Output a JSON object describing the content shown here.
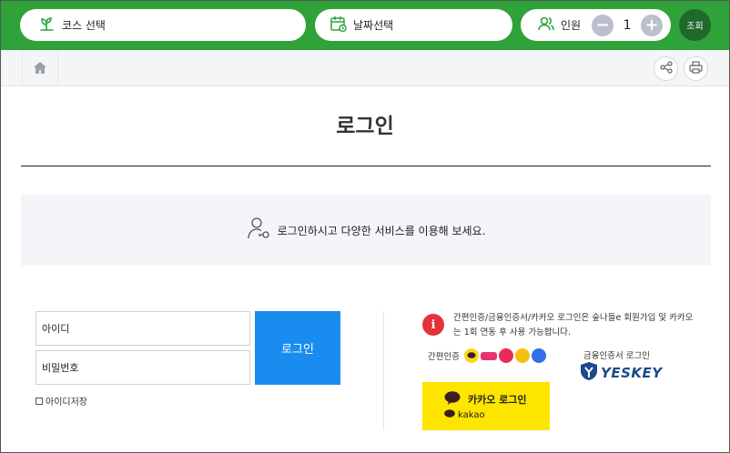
{
  "topbar": {
    "course_label": "코스 선택",
    "date_label": "날짜선택",
    "people_label": "인원",
    "people_count": "1",
    "minus_symbol": "−",
    "plus_symbol": "+",
    "search_label": "조회",
    "brand_color": "#2fa23a"
  },
  "breadcrumb": {
    "home_icon": "home-icon",
    "share_icon": "share-icon",
    "print_icon": "printer-icon"
  },
  "page": {
    "title": "로그인"
  },
  "notice": {
    "icon": "user-key-icon",
    "text": "로그인하시고 다양한 서비스를 이용해 보세요."
  },
  "login_form": {
    "id_placeholder": "아이디",
    "pw_placeholder": "비밀번호",
    "login_button": "로그인",
    "save_id_label": "아이디저장",
    "button_color": "#1a8cf0"
  },
  "side": {
    "info_symbol": "i",
    "info_text": "간편인증/금융인증서/카카오 로그인은 숲나들e 회원가입 및 카카오는 1회 연동 후 사용 가능합니다.",
    "easy_auth_label": "간편인증",
    "easy_logos": [
      "kakao",
      "toss",
      "pass",
      "naver",
      "pass"
    ],
    "cert_label": "금융인증서 로그인",
    "yeskey_text": "YESKEY",
    "kakao_button_text": "카카오 로그인",
    "kakao_brand": "kakao",
    "kakao_color": "#fee500"
  }
}
